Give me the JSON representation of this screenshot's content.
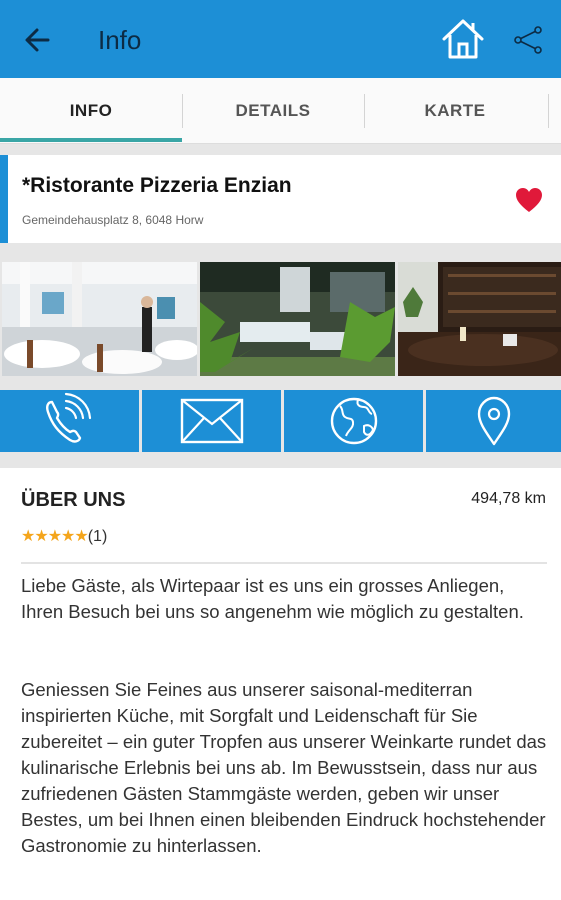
{
  "appbar": {
    "title": "Info",
    "back_icon": "arrow-left-icon",
    "home_icon": "home-icon",
    "share_icon": "share-icon",
    "color": "#1d8fd6"
  },
  "tabs": [
    {
      "label": "INFO",
      "active": true
    },
    {
      "label": "DETAILS",
      "active": false
    },
    {
      "label": "KARTE",
      "active": false
    }
  ],
  "restaurant": {
    "name": "*Ristorante Pizzeria Enzian",
    "address": "Gemeindehausplatz 8, 6048 Horw",
    "favorite": true,
    "favorite_color": "#e0193a"
  },
  "photos": [
    "restaurant-interior-photo",
    "terrace-photo",
    "wine-bar-photo"
  ],
  "actions": [
    {
      "icon": "phone-icon"
    },
    {
      "icon": "mail-icon"
    },
    {
      "icon": "globe-icon"
    },
    {
      "icon": "location-pin-icon"
    }
  ],
  "about": {
    "heading": "ÜBER UNS",
    "distance": "494,78 km",
    "stars": "★★★★★",
    "rating_count": "(1)",
    "paragraph1": "Liebe Gäste, als Wirtepaar ist es uns ein grosses Anliegen, Ihren Besuch bei uns so angenehm wie möglich zu gestalten.",
    "paragraph2": "Geniessen Sie Feines aus unserer saisonal-mediterran inspirierten Küche, mit Sorgfalt und Leidenschaft für Sie zubereitet – ein guter Tropfen aus unserer Weinkarte rundet das kulinarische Erlebnis bei uns ab. Im Bewusstsein, dass nur aus zufriedenen Gästen Stammgäste werden, geben wir unser Bestes, um bei Ihnen einen bleibenden Eindruck hochstehender Gastronomie zu hinterlassen."
  }
}
